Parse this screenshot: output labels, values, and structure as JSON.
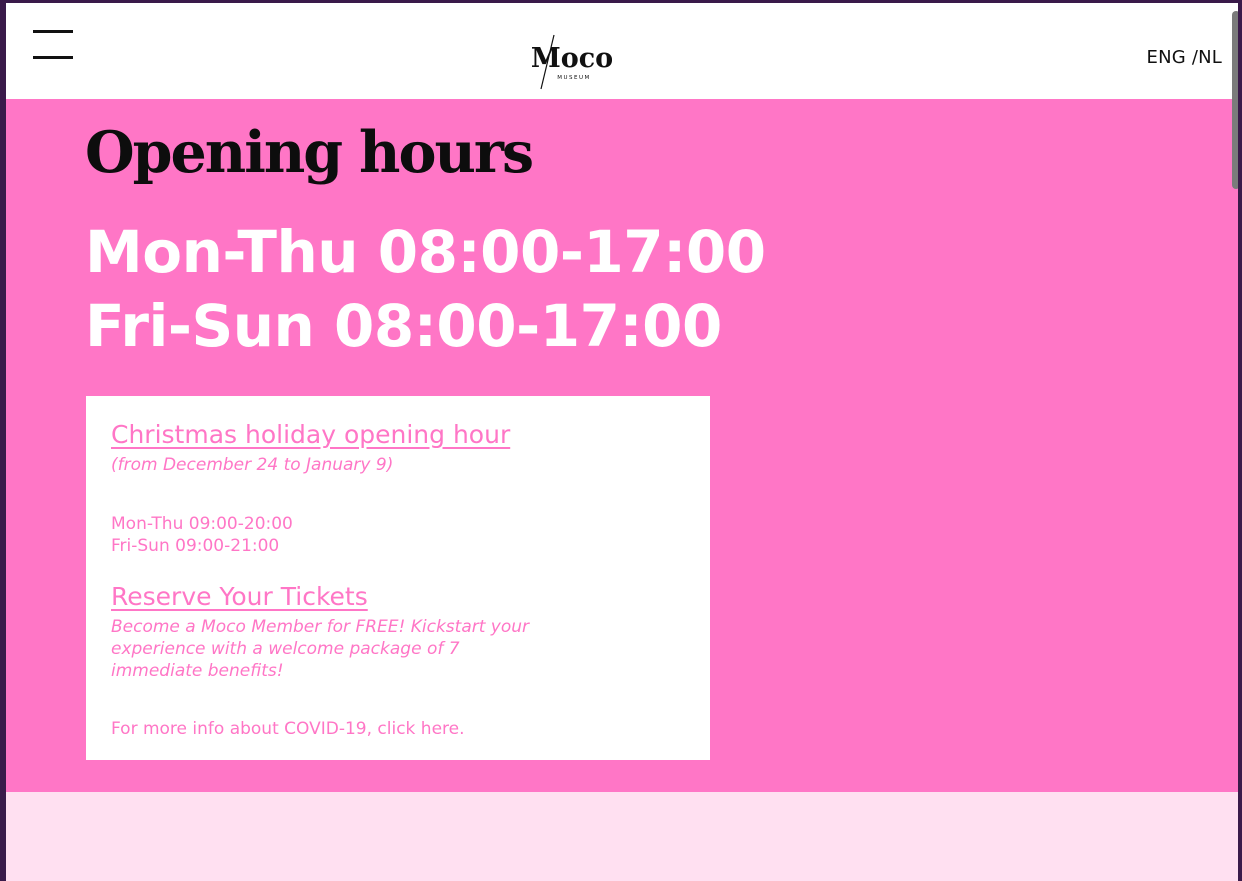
{
  "header": {
    "logo_text": "Moco",
    "logo_subtext": "MUSEUM",
    "lang_eng": "ENG",
    "lang_sep": " /",
    "lang_nl": "NL"
  },
  "main": {
    "title": "Opening hours",
    "hours_line1": "Mon-Thu 08:00-17:00",
    "hours_line2": "Fri-Sun 08:00-17:00"
  },
  "card": {
    "christmas_title": "Christmas holiday opening hour",
    "christmas_dates": "(from December 24 to January 9)",
    "christmas_line1": "Mon-Thu 09:00-20:00",
    "christmas_line2": "Fri-Sun 09:00-21:00",
    "reserve_title": "Reserve Your Tickets",
    "reserve_text": "Become a Moco Member for FREE! Kickstart your experience with a welcome package of 7 immediate benefits!",
    "covid_prefix": "For more info about COVID-19, ",
    "covid_link": "click here."
  },
  "colors": {
    "accent_pink": "#ff76c6",
    "light_pink": "#ffe0f1",
    "heading_dark": "#0d0d0d"
  }
}
